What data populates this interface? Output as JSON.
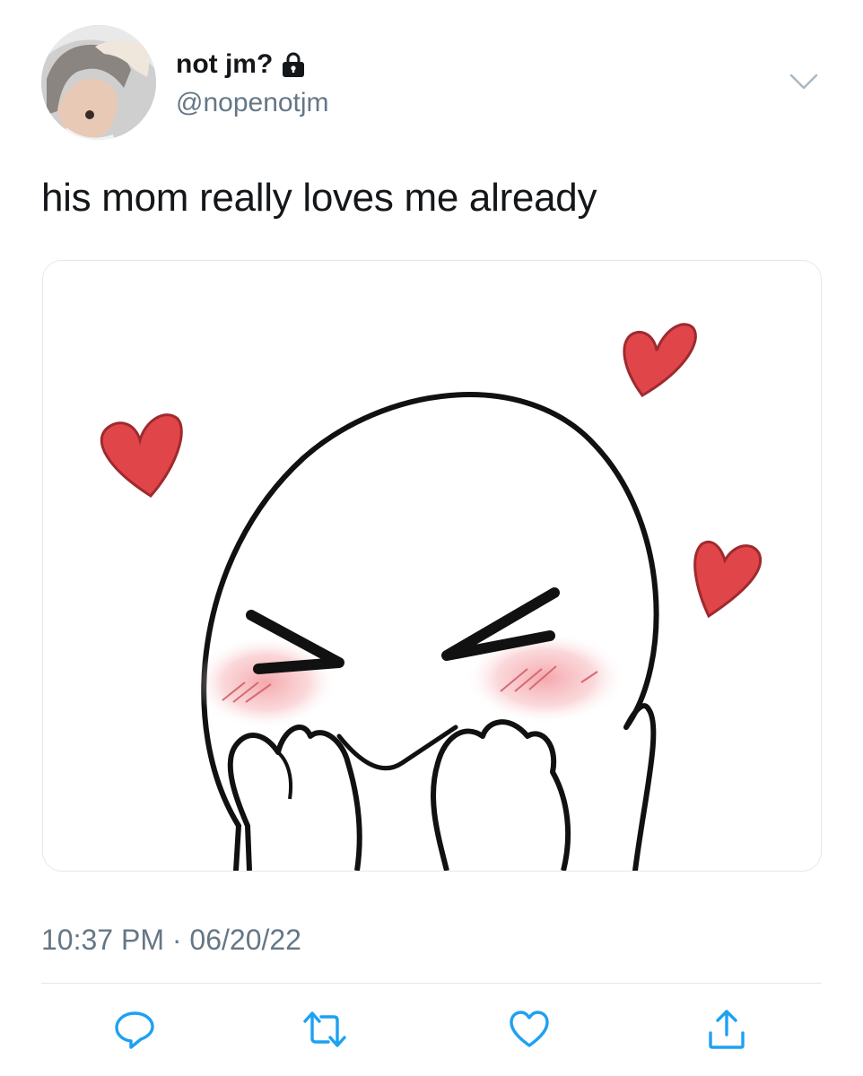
{
  "user": {
    "display_name": "not jm?",
    "handle": "@nopenotjm",
    "protected_icon": "lock-icon",
    "avatar_alt": "profile photo"
  },
  "tweet": {
    "text": "his mom really loves me already",
    "media_description": "cartoon face with squinting eyes, blush and hearts",
    "timestamp": "10:37 PM · 06/20/22"
  },
  "actions": [
    {
      "name": "reply",
      "icon": "reply-icon"
    },
    {
      "name": "retweet",
      "icon": "retweet-icon"
    },
    {
      "name": "like",
      "icon": "heart-icon"
    },
    {
      "name": "share",
      "icon": "share-icon"
    }
  ],
  "colors": {
    "text": "#14171a",
    "secondary_text": "#657786",
    "border": "#e1e8ed",
    "icon": "#1da1f2",
    "heart": "#e0454a"
  }
}
